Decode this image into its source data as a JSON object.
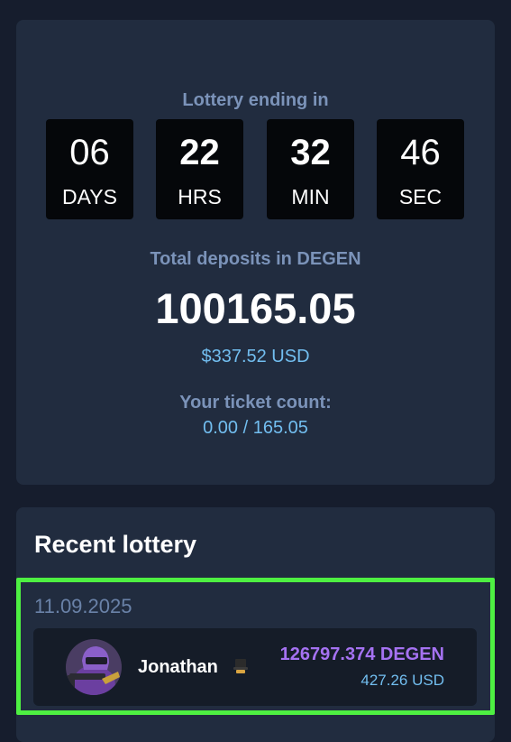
{
  "lottery": {
    "ending_label": "Lottery ending in",
    "countdown": [
      {
        "value": "06",
        "unit": "DAYS"
      },
      {
        "value": "22",
        "unit": "HRS"
      },
      {
        "value": "32",
        "unit": "MIN"
      },
      {
        "value": "46",
        "unit": "SEC"
      }
    ],
    "total_label": "Total deposits in DEGEN",
    "total_amount": "100165.05",
    "total_usd": "$337.52 USD",
    "ticket_label": "Your ticket count:",
    "ticket_value": "0.00 / 165.05"
  },
  "recent": {
    "title": "Recent lottery",
    "entry": {
      "date": "11.09.2025",
      "winner_name": "Jonathan",
      "winner_badge_icon": "crown-icon",
      "amount": "126797.374 DEGEN",
      "usd": "427.26 USD"
    }
  },
  "colors": {
    "background": "#161d2d",
    "card": "#212c3f",
    "muted_heading": "#7b93b9",
    "usd_blue": "#72bef0",
    "degen_purple": "#a572f2",
    "highlight_green": "#4ef042"
  }
}
